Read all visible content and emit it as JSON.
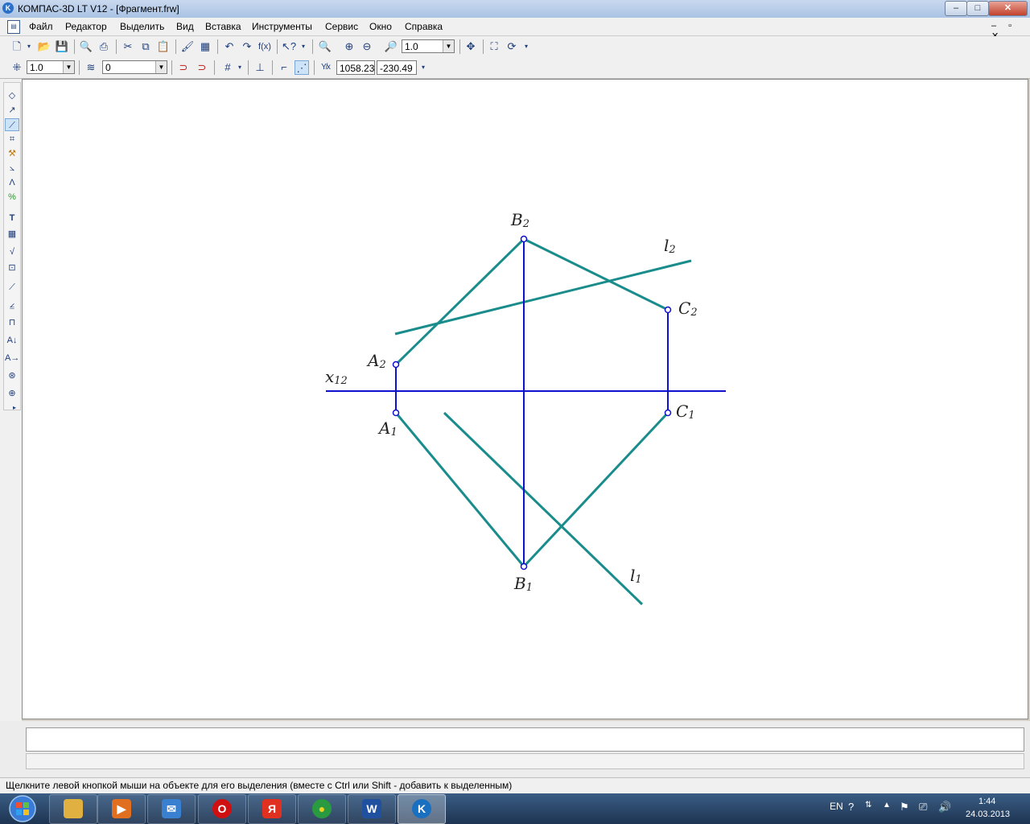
{
  "window": {
    "title": "КОМПАС-3D LT V12 - [Фрагмент.frw]",
    "min_glyph": "–",
    "max_glyph": "□",
    "close_glyph": "✕"
  },
  "menu": [
    "Файл",
    "Редактор",
    "Выделить",
    "Вид",
    "Вставка",
    "Инструменты",
    "Сервис",
    "Окно",
    "Справка"
  ],
  "mdi_controls": "– ▫ ✕",
  "toolbar1": {
    "zoom_value": "1.0"
  },
  "toolbar2": {
    "step_value": "1.0",
    "layer_value": "0",
    "coord_x": "1058.23",
    "coord_y": "-230.49"
  },
  "drawing": {
    "line_color_main": "#1a8c8c",
    "line_color_construction": "#1010d0",
    "labels": {
      "B2": {
        "main": "B",
        "sub": "2"
      },
      "A2": {
        "main": "A",
        "sub": "2"
      },
      "C2": {
        "main": "C",
        "sub": "2"
      },
      "l2": {
        "main": "l",
        "sub": "2"
      },
      "x12": {
        "main": "x",
        "sub": "12"
      },
      "A1": {
        "main": "A",
        "sub": "1"
      },
      "B1": {
        "main": "B",
        "sub": "1"
      },
      "C1": {
        "main": "C",
        "sub": "1"
      },
      "l1": {
        "main": "l",
        "sub": "1"
      }
    }
  },
  "status": "Щелкните левой кнопкой мыши на объекте для его выделения (вместе с Ctrl или Shift - добавить к выделенным)",
  "taskbar": {
    "apps": [
      {
        "name": "explorer-icon",
        "glyph": "",
        "color": "#e0b040"
      },
      {
        "name": "media-player-icon",
        "glyph": "▶",
        "color": "#e07020"
      },
      {
        "name": "mail-icon",
        "glyph": "✉",
        "color": "#3a80d0"
      },
      {
        "name": "opera-icon",
        "glyph": "O",
        "color": "#d01010"
      },
      {
        "name": "yandex-icon",
        "glyph": "Я",
        "color": "#e03020"
      },
      {
        "name": "chrome-icon",
        "glyph": "●",
        "color": "#2a9a40"
      },
      {
        "name": "word-icon",
        "glyph": "W",
        "color": "#2050a0"
      },
      {
        "name": "kompas-icon",
        "glyph": "K",
        "color": "#1a70c0"
      }
    ],
    "lang": "EN",
    "time": "1:44",
    "date": "24.03.2013"
  }
}
